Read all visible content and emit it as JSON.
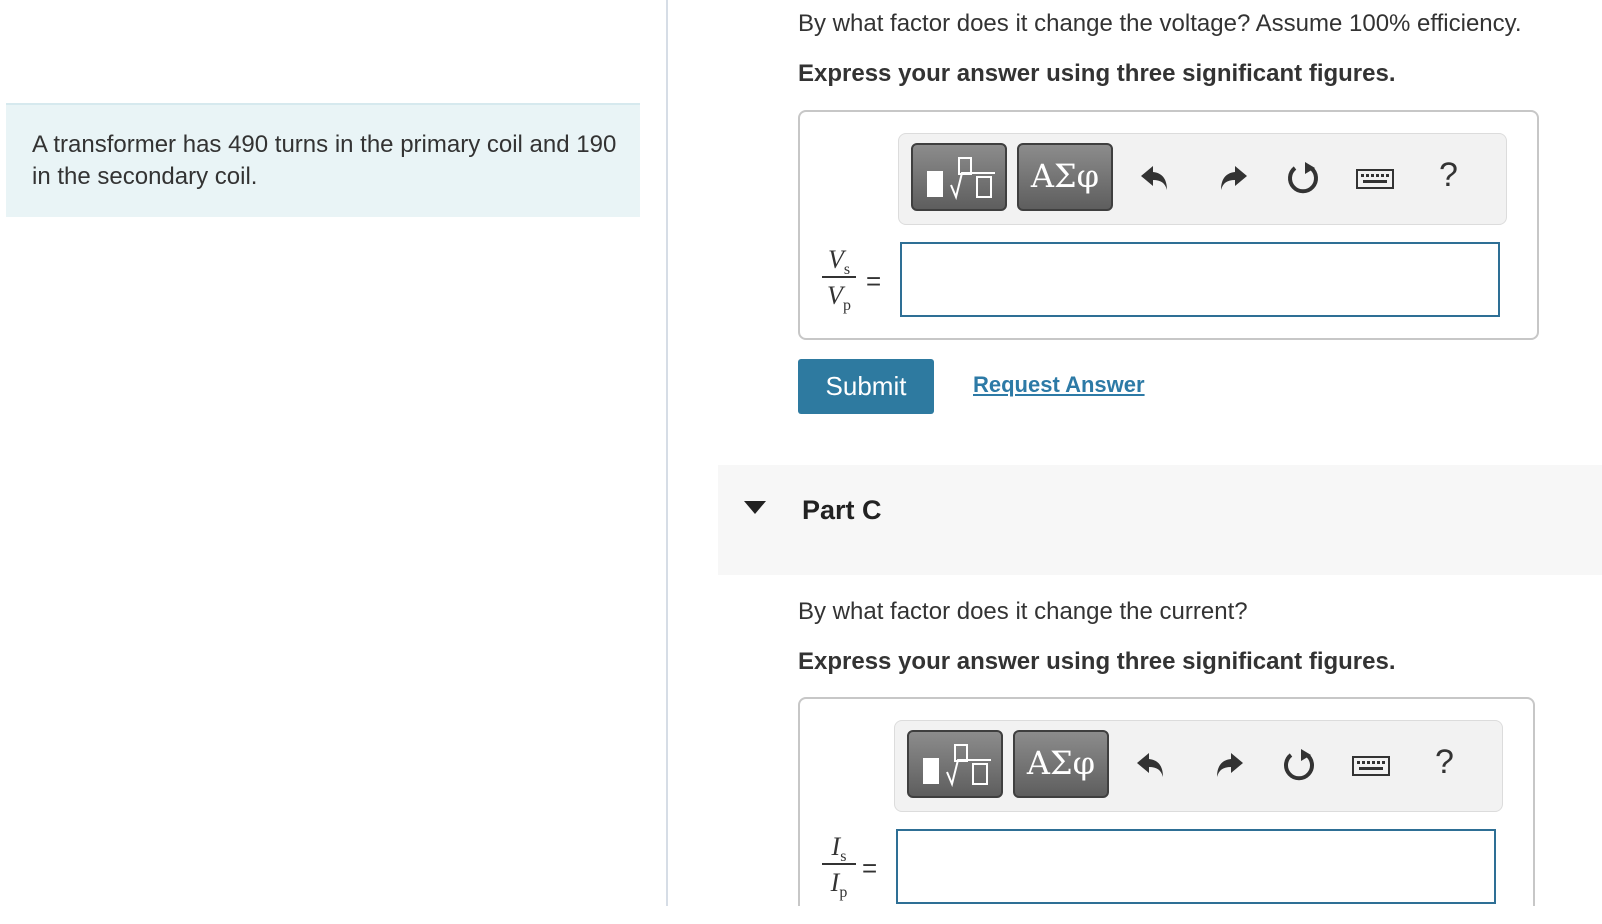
{
  "problem": {
    "text": "A transformer has 490 turns in the primary coil and 190 in the secondary coil."
  },
  "part_b": {
    "question": "By what factor does it change the voltage? Assume 100% efficiency.",
    "instruction": "Express your answer using three significant figures.",
    "fraction": {
      "numerator_var": "V",
      "numerator_sub": "s",
      "denominator_var": "V",
      "denominator_sub": "p"
    },
    "equals": "=",
    "input_value": "",
    "submit_label": "Submit",
    "request_label": "Request Answer"
  },
  "part_c": {
    "title": "Part C",
    "question": "By what factor does it change the current?",
    "instruction": "Express your answer using three significant figures.",
    "fraction": {
      "numerator_var": "I",
      "numerator_sub": "s",
      "denominator_var": "I",
      "denominator_sub": "p"
    },
    "equals": "=",
    "input_value": ""
  },
  "toolbar": {
    "templates_icon": "templates-icon",
    "greek_label": "ΑΣφ",
    "undo_icon": "undo-icon",
    "redo_icon": "redo-icon",
    "reset_icon": "reset-icon",
    "keyboard_icon": "keyboard-icon",
    "help_label": "?"
  },
  "colors": {
    "problem_bg": "#e9f4f6",
    "submit_bg": "#2e7aa0",
    "link": "#2d7aa6",
    "input_border": "#2e6f95"
  }
}
